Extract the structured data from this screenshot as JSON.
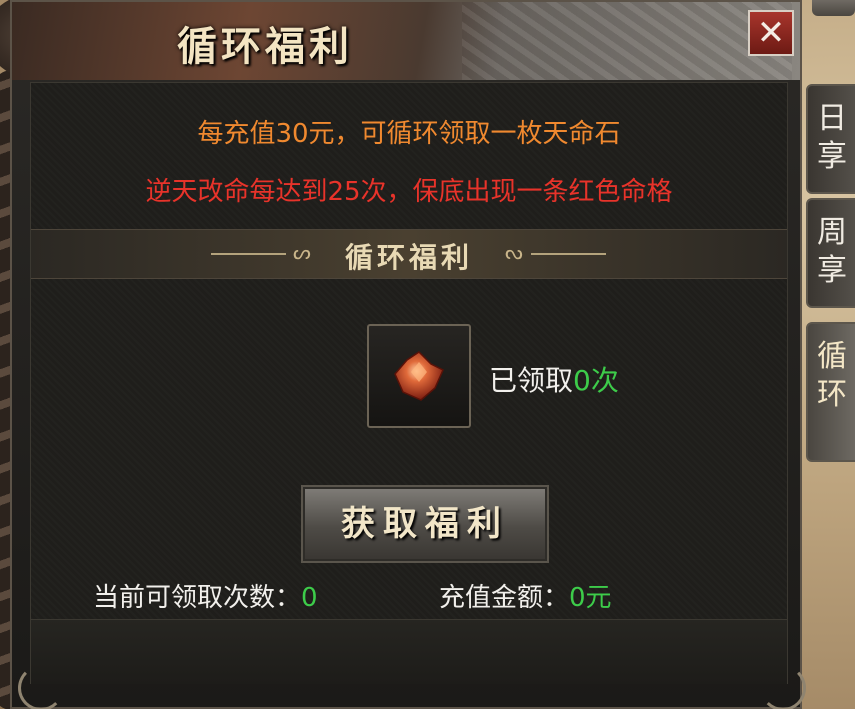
{
  "panel": {
    "title": "循环福利",
    "close_label": "✕"
  },
  "info": {
    "line1": "每充值30元，可循环领取一枚天命石",
    "line2": "逆天改命每达到25次，保底出现一条红色命格"
  },
  "section": {
    "title": "循环福利",
    "left_ornament": "ᔕ",
    "right_ornament": "ᔓ"
  },
  "item": {
    "icon": "fate-stone-icon",
    "claimed_prefix": "已领取",
    "claimed_count": "0次"
  },
  "action": {
    "button_label": "获取福利"
  },
  "stats": {
    "available_label": "当前可领取次数：",
    "available_value": "0",
    "recharge_label": "充值金额：",
    "recharge_value": "0元"
  },
  "side_tabs": [
    {
      "line1": "日",
      "line2": "享",
      "active": false
    },
    {
      "line1": "周",
      "line2": "享",
      "active": false
    },
    {
      "line1": "循",
      "line2": "环",
      "active": true
    }
  ],
  "colors": {
    "accent_orange": "#f0892f",
    "accent_red": "#e8332a",
    "value_green": "#3dcc4a",
    "title_gold": "#f3e4c2"
  }
}
